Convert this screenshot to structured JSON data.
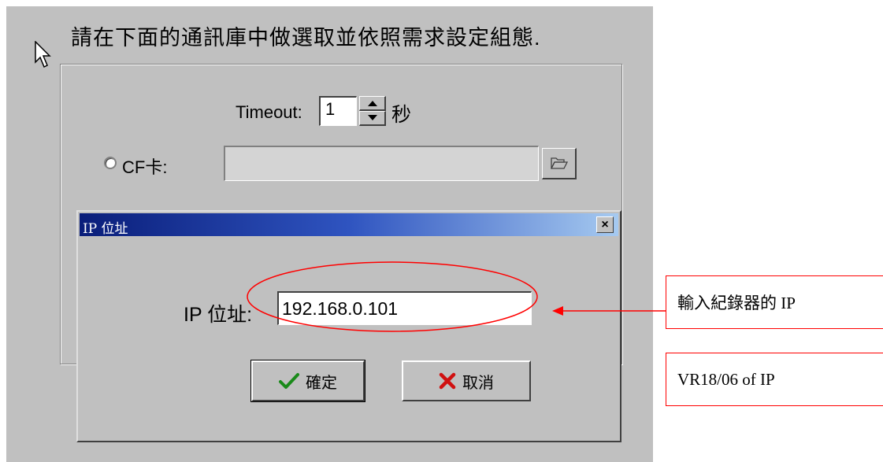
{
  "instruction": "請在下面的通訊庫中做選取並依照需求設定組態.",
  "timeout": {
    "label": "Timeout:",
    "value": "1",
    "unit": "秒"
  },
  "cf_card": {
    "label": "CF卡:",
    "path": ""
  },
  "ip_dialog": {
    "title": "IP 位址",
    "close_label": "×",
    "field_label": "IP 位址:",
    "ip_value": "192.168.0.101",
    "ok_label": "確定",
    "cancel_label": "取消"
  },
  "annotations": {
    "callout_ip": "輸入紀錄器的 IP",
    "callout_vr": "VR18/06 of IP",
    "color": "#ff0000"
  },
  "colors": {
    "dialog_bg": "#c0c0c0",
    "title_start": "#0a1e7a",
    "title_end": "#a6caf0"
  }
}
